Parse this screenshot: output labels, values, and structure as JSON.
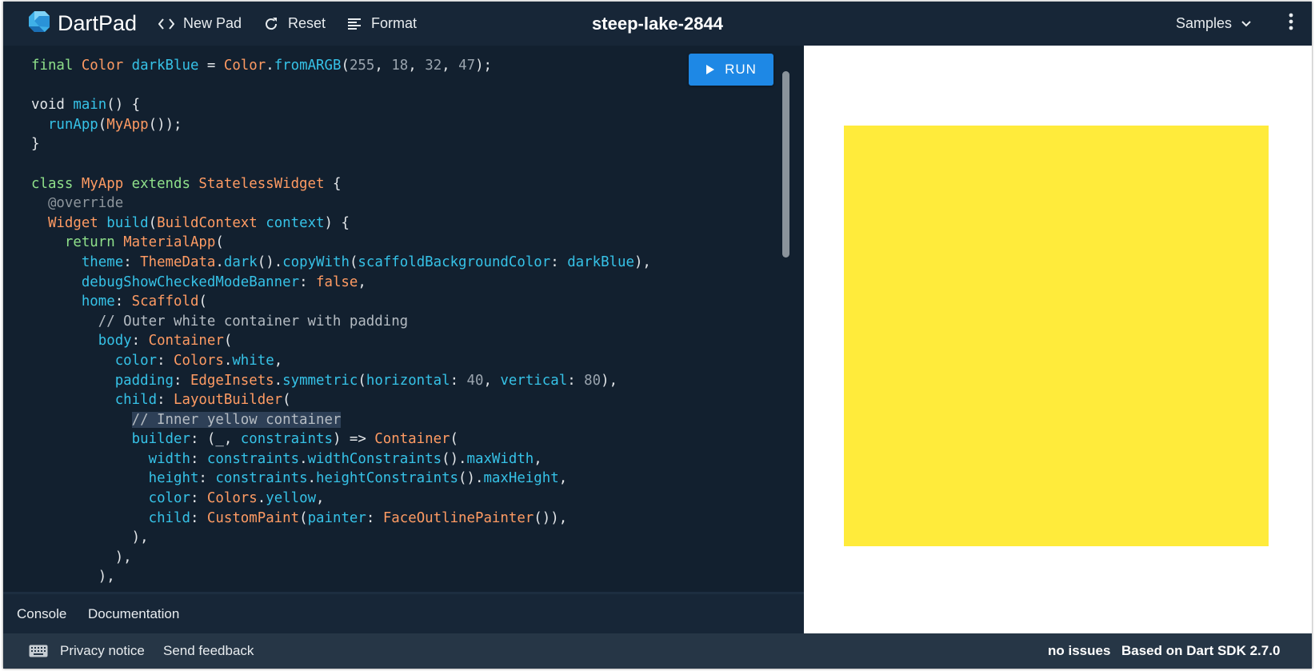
{
  "header": {
    "app_name": "DartPad",
    "new_pad_label": "New Pad",
    "reset_label": "Reset",
    "format_label": "Format",
    "pad_title": "steep-lake-2844",
    "samples_label": "Samples",
    "icons": {
      "logo": "dart-logo-icon",
      "new_pad": "code-brackets-icon",
      "reset": "refresh-icon",
      "format": "format-align-icon",
      "samples": "chevron-down-icon",
      "more": "more-vert-icon"
    }
  },
  "editor": {
    "run_label": "RUN",
    "code_lines": [
      [
        [
          "kw",
          "final "
        ],
        [
          "type",
          "Color "
        ],
        [
          "prop",
          "darkBlue"
        ],
        [
          "plain",
          " = "
        ],
        [
          "type",
          "Color"
        ],
        [
          "plain",
          "."
        ],
        [
          "prop",
          "fromARGB"
        ],
        [
          "plain",
          "("
        ],
        [
          "num",
          "255"
        ],
        [
          "plain",
          ", "
        ],
        [
          "num",
          "18"
        ],
        [
          "plain",
          ", "
        ],
        [
          "num",
          "32"
        ],
        [
          "plain",
          ", "
        ],
        [
          "num",
          "47"
        ],
        [
          "plain",
          ");"
        ]
      ],
      [],
      [
        [
          "plain",
          "void "
        ],
        [
          "prop",
          "main"
        ],
        [
          "plain",
          "() {"
        ]
      ],
      [
        [
          "plain",
          "  "
        ],
        [
          "prop",
          "runApp"
        ],
        [
          "plain",
          "("
        ],
        [
          "type",
          "MyApp"
        ],
        [
          "plain",
          "());"
        ]
      ],
      [
        [
          "plain",
          "}"
        ]
      ],
      [],
      [
        [
          "kw",
          "class "
        ],
        [
          "type",
          "MyApp "
        ],
        [
          "kw",
          "extends "
        ],
        [
          "type",
          "StatelessWidget"
        ],
        [
          "plain",
          " {"
        ]
      ],
      [
        [
          "plain",
          "  "
        ],
        [
          "anno",
          "@override"
        ]
      ],
      [
        [
          "plain",
          "  "
        ],
        [
          "type",
          "Widget "
        ],
        [
          "prop",
          "build"
        ],
        [
          "plain",
          "("
        ],
        [
          "type",
          "BuildContext "
        ],
        [
          "prop",
          "context"
        ],
        [
          "plain",
          ") {"
        ]
      ],
      [
        [
          "plain",
          "    "
        ],
        [
          "kw",
          "return "
        ],
        [
          "type",
          "MaterialApp"
        ],
        [
          "plain",
          "("
        ]
      ],
      [
        [
          "plain",
          "      "
        ],
        [
          "prop",
          "theme"
        ],
        [
          "plain",
          ": "
        ],
        [
          "type",
          "ThemeData"
        ],
        [
          "plain",
          "."
        ],
        [
          "prop",
          "dark"
        ],
        [
          "plain",
          "()."
        ],
        [
          "prop",
          "copyWith"
        ],
        [
          "plain",
          "("
        ],
        [
          "prop",
          "scaffoldBackgroundColor"
        ],
        [
          "plain",
          ": "
        ],
        [
          "prop",
          "darkBlue"
        ],
        [
          "plain",
          "),"
        ]
      ],
      [
        [
          "plain",
          "      "
        ],
        [
          "prop",
          "debugShowCheckedModeBanner"
        ],
        [
          "plain",
          ": "
        ],
        [
          "type",
          "false"
        ],
        [
          "plain",
          ","
        ]
      ],
      [
        [
          "plain",
          "      "
        ],
        [
          "prop",
          "home"
        ],
        [
          "plain",
          ": "
        ],
        [
          "type",
          "Scaffold"
        ],
        [
          "plain",
          "("
        ]
      ],
      [
        [
          "plain",
          "        "
        ],
        [
          "comment",
          "// Outer white container with padding"
        ]
      ],
      [
        [
          "plain",
          "        "
        ],
        [
          "prop",
          "body"
        ],
        [
          "plain",
          ": "
        ],
        [
          "type",
          "Container"
        ],
        [
          "plain",
          "("
        ]
      ],
      [
        [
          "plain",
          "          "
        ],
        [
          "prop",
          "color"
        ],
        [
          "plain",
          ": "
        ],
        [
          "type",
          "Colors"
        ],
        [
          "plain",
          "."
        ],
        [
          "prop",
          "white"
        ],
        [
          "plain",
          ","
        ]
      ],
      [
        [
          "plain",
          "          "
        ],
        [
          "prop",
          "padding"
        ],
        [
          "plain",
          ": "
        ],
        [
          "type",
          "EdgeInsets"
        ],
        [
          "plain",
          "."
        ],
        [
          "prop",
          "symmetric"
        ],
        [
          "plain",
          "("
        ],
        [
          "prop",
          "horizontal"
        ],
        [
          "plain",
          ": "
        ],
        [
          "num",
          "40"
        ],
        [
          "plain",
          ", "
        ],
        [
          "prop",
          "vertical"
        ],
        [
          "plain",
          ": "
        ],
        [
          "num",
          "80"
        ],
        [
          "plain",
          "),"
        ]
      ],
      [
        [
          "plain",
          "          "
        ],
        [
          "prop",
          "child"
        ],
        [
          "plain",
          ": "
        ],
        [
          "type",
          "LayoutBuilder"
        ],
        [
          "plain",
          "("
        ]
      ],
      [
        [
          "plain",
          "            "
        ],
        [
          "comment hl",
          "// Inner yellow container"
        ]
      ],
      [
        [
          "plain",
          "            "
        ],
        [
          "prop",
          "builder"
        ],
        [
          "plain",
          ": (_, "
        ],
        [
          "prop",
          "constraints"
        ],
        [
          "plain",
          ") => "
        ],
        [
          "type",
          "Container"
        ],
        [
          "plain",
          "("
        ]
      ],
      [
        [
          "plain",
          "              "
        ],
        [
          "prop",
          "width"
        ],
        [
          "plain",
          ": "
        ],
        [
          "prop",
          "constraints"
        ],
        [
          "plain",
          "."
        ],
        [
          "prop",
          "widthConstraints"
        ],
        [
          "plain",
          "()."
        ],
        [
          "prop",
          "maxWidth"
        ],
        [
          "plain",
          ","
        ]
      ],
      [
        [
          "plain",
          "              "
        ],
        [
          "prop",
          "height"
        ],
        [
          "plain",
          ": "
        ],
        [
          "prop",
          "constraints"
        ],
        [
          "plain",
          "."
        ],
        [
          "prop",
          "heightConstraints"
        ],
        [
          "plain",
          "()."
        ],
        [
          "prop",
          "maxHeight"
        ],
        [
          "plain",
          ","
        ]
      ],
      [
        [
          "plain",
          "              "
        ],
        [
          "prop",
          "color"
        ],
        [
          "plain",
          ": "
        ],
        [
          "type",
          "Colors"
        ],
        [
          "plain",
          "."
        ],
        [
          "prop",
          "yellow"
        ],
        [
          "plain",
          ","
        ]
      ],
      [
        [
          "plain",
          "              "
        ],
        [
          "prop",
          "child"
        ],
        [
          "plain",
          ": "
        ],
        [
          "type",
          "CustomPaint"
        ],
        [
          "plain",
          "("
        ],
        [
          "prop",
          "painter"
        ],
        [
          "plain",
          ": "
        ],
        [
          "type",
          "FaceOutlinePainter"
        ],
        [
          "plain",
          "()),"
        ]
      ],
      [
        [
          "plain",
          "            ),"
        ]
      ],
      [
        [
          "plain",
          "          ),"
        ]
      ],
      [
        [
          "plain",
          "        ),"
        ]
      ]
    ]
  },
  "console_tabs": {
    "console_label": "Console",
    "documentation_label": "Documentation"
  },
  "output": {
    "background_color": "#ffffff",
    "box_color": "#ffeb3b"
  },
  "footer": {
    "privacy_label": "Privacy notice",
    "feedback_label": "Send feedback",
    "issues_label": "no issues",
    "sdk_label": "Based on Dart SDK 2.7.0",
    "keyboard_icon": "keyboard-icon"
  },
  "colors": {
    "accent": "#1e88e5",
    "editor_bg": "#12202f",
    "header_bg": "#172637",
    "footer_bg": "#263646"
  }
}
